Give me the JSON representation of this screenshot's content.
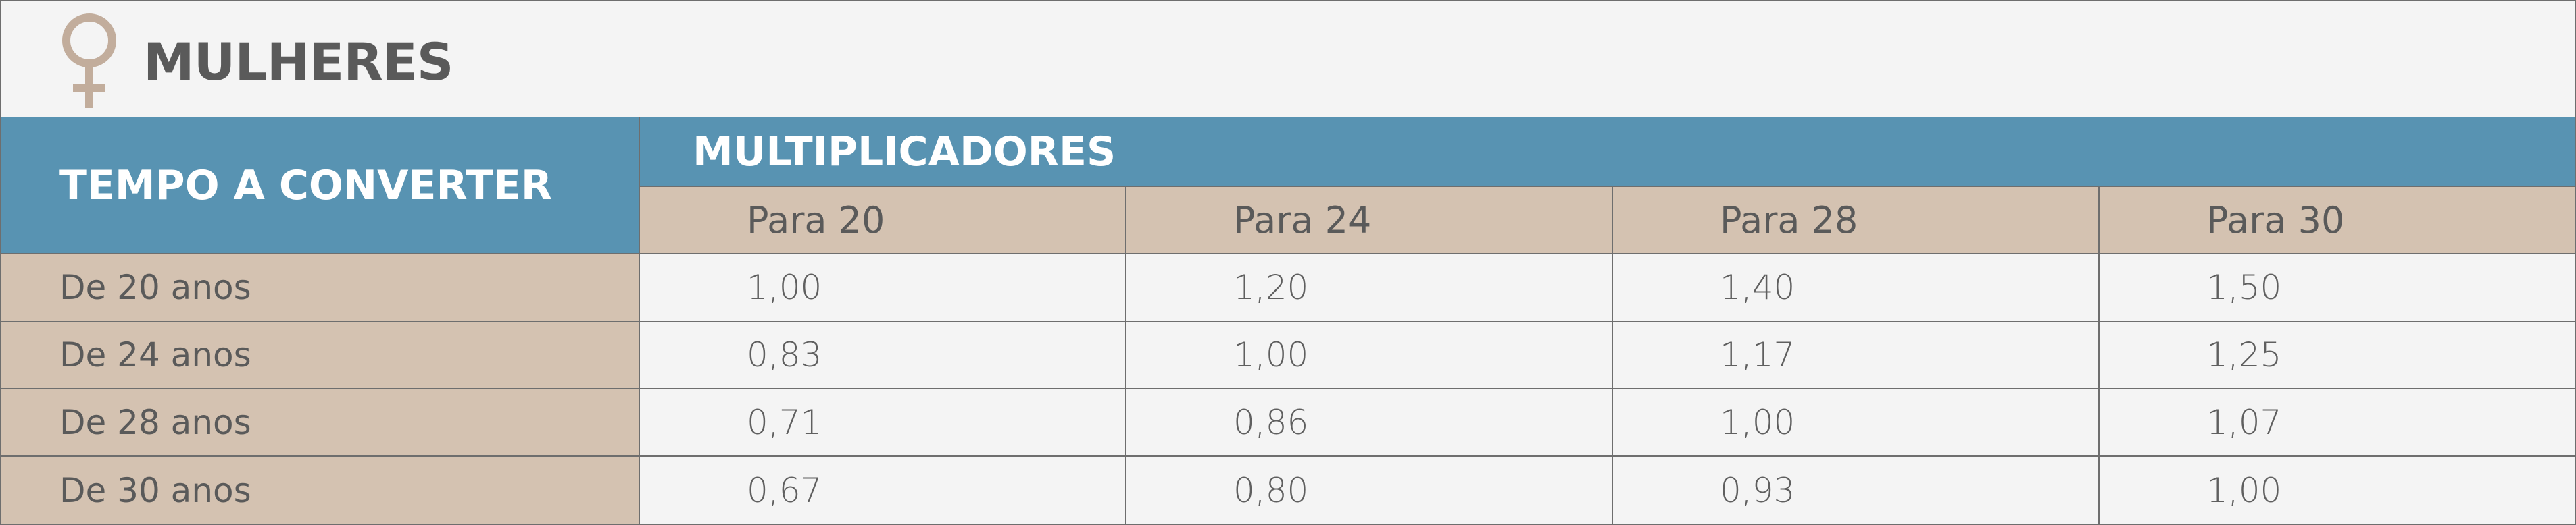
{
  "header": {
    "title": "MULHERES",
    "icon": "female-symbol-icon",
    "icon_color": "#c2ad9c"
  },
  "table": {
    "corner_label": "TEMPO A CONVERTER",
    "group_label": "MULTIPLICADORES",
    "columns": [
      "Para 20",
      "Para 24",
      "Para 28",
      "Para 30"
    ],
    "rows": [
      {
        "label": "De 20 anos",
        "values": [
          "1,00",
          "1,20",
          "1,40",
          "1,50"
        ]
      },
      {
        "label": "De 24 anos",
        "values": [
          "0,83",
          "1,00",
          "1,17",
          "1,25"
        ]
      },
      {
        "label": "De 28 anos",
        "values": [
          "0,71",
          "0,86",
          "1,00",
          "1,07"
        ]
      },
      {
        "label": "De 30 anos",
        "values": [
          "0,67",
          "0,80",
          "0,93",
          "1,00"
        ]
      }
    ]
  },
  "colors": {
    "header_blue": "#5893b2",
    "beige": "#d4c2b1",
    "background": "#f4f4f4",
    "border": "#6e6e6e"
  }
}
